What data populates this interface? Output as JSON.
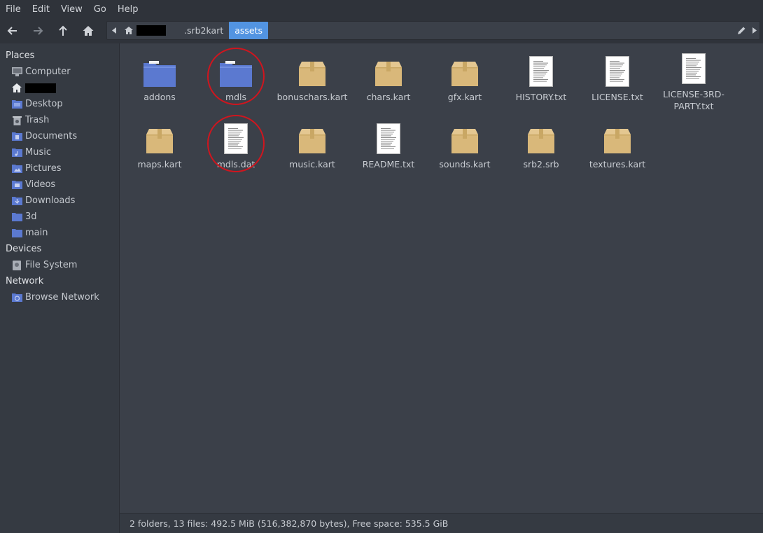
{
  "menu": [
    "File",
    "Edit",
    "View",
    "Go",
    "Help"
  ],
  "path": {
    "segments": [
      ".srb2kart",
      "assets"
    ],
    "active_index": 1
  },
  "sidebar": {
    "places_header": "Places",
    "places": [
      {
        "label": "Computer",
        "icon": "computer-icon"
      },
      {
        "label": "",
        "icon": "home-icon",
        "redacted": true
      },
      {
        "label": "Desktop",
        "icon": "desktop-folder-icon"
      },
      {
        "label": "Trash",
        "icon": "trash-icon"
      },
      {
        "label": "Documents",
        "icon": "documents-folder-icon"
      },
      {
        "label": "Music",
        "icon": "music-folder-icon"
      },
      {
        "label": "Pictures",
        "icon": "pictures-folder-icon"
      },
      {
        "label": "Videos",
        "icon": "videos-folder-icon"
      },
      {
        "label": "Downloads",
        "icon": "downloads-folder-icon"
      },
      {
        "label": "3d",
        "icon": "folder-icon"
      },
      {
        "label": "main",
        "icon": "folder-icon"
      }
    ],
    "devices_header": "Devices",
    "devices": [
      {
        "label": "File System",
        "icon": "drive-icon"
      }
    ],
    "network_header": "Network",
    "network": [
      {
        "label": "Browse Network",
        "icon": "network-icon"
      }
    ]
  },
  "files": [
    {
      "label": "addons",
      "type": "folder"
    },
    {
      "label": "mdls",
      "type": "folder",
      "highlighted": true
    },
    {
      "label": "bonuschars.kart",
      "type": "archive"
    },
    {
      "label": "chars.kart",
      "type": "archive"
    },
    {
      "label": "gfx.kart",
      "type": "archive"
    },
    {
      "label": "HISTORY.txt",
      "type": "text"
    },
    {
      "label": "LICENSE.txt",
      "type": "text"
    },
    {
      "label": "LICENSE-3RD-PARTY.txt",
      "type": "text"
    },
    {
      "label": "maps.kart",
      "type": "archive"
    },
    {
      "label": "mdls.dat",
      "type": "text",
      "highlighted": true
    },
    {
      "label": "music.kart",
      "type": "archive"
    },
    {
      "label": "README.txt",
      "type": "text"
    },
    {
      "label": "sounds.kart",
      "type": "archive"
    },
    {
      "label": "srb2.srb",
      "type": "archive"
    },
    {
      "label": "textures.kart",
      "type": "archive"
    }
  ],
  "status": "2 folders, 13 files: 492.5  MiB (516,382,870 bytes), Free space: 535.5  GiB",
  "colors": {
    "accent": "#5294e2",
    "folder_blue": "#5b79d0",
    "archive_tan": "#d9b87a",
    "highlight_ring": "#d0151e"
  }
}
